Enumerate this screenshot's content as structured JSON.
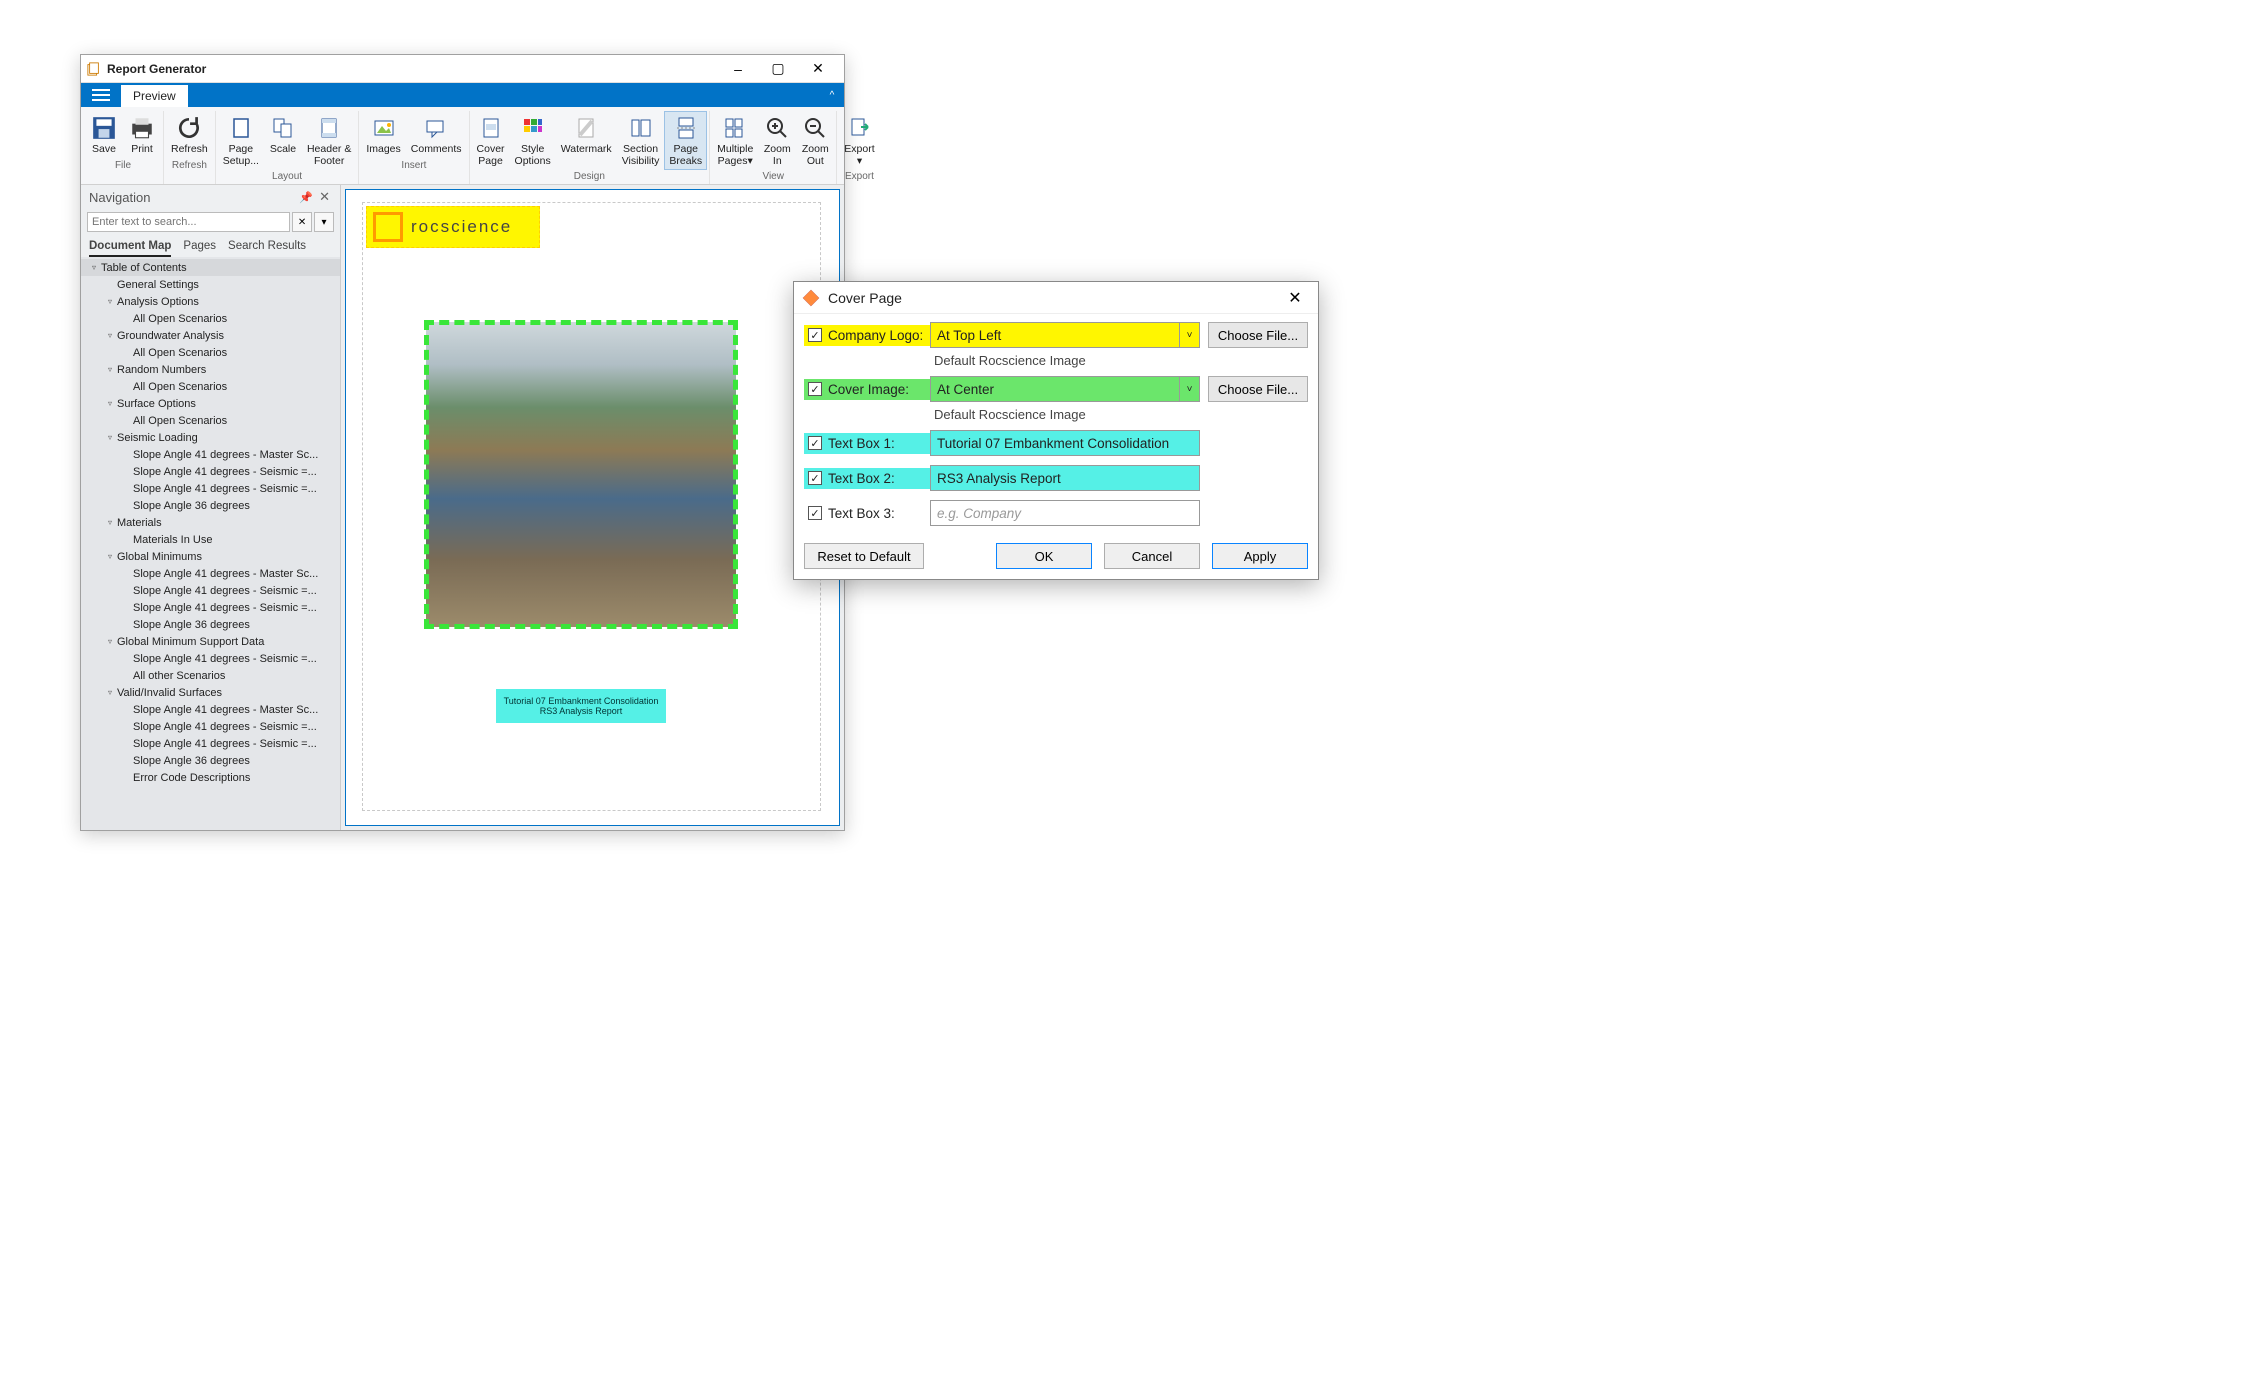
{
  "window": {
    "title": "Report Generator",
    "min_label": "–",
    "max_label": "▢",
    "close_label": "✕",
    "menu": {
      "preview": "Preview",
      "caret": "^"
    }
  },
  "ribbon": {
    "groups": {
      "file": {
        "label": "File",
        "save": "Save",
        "print": "Print"
      },
      "refresh": {
        "label": "Refresh",
        "refresh": "Refresh"
      },
      "layout": {
        "label": "Layout",
        "page_setup": "Page\nSetup...",
        "scale": "Scale",
        "header_footer": "Header &\nFooter"
      },
      "insert": {
        "label": "Insert",
        "images": "Images",
        "comments": "Comments"
      },
      "design": {
        "label": "Design",
        "cover": "Cover\nPage",
        "style": "Style\nOptions",
        "watermark": "Watermark",
        "section": "Section\nVisibility",
        "breaks": "Page\nBreaks"
      },
      "view": {
        "label": "View",
        "multi": "Multiple\nPages▾",
        "zin": "Zoom\nIn",
        "zout": "Zoom\nOut"
      },
      "export": {
        "label": "Export",
        "export": "Export\n▾"
      }
    }
  },
  "nav": {
    "title": "Navigation",
    "search_placeholder": "Enter text to search...",
    "clear": "✕",
    "go": "▾",
    "tabs": {
      "map": "Document Map",
      "pages": "Pages",
      "results": "Search Results"
    },
    "tree": [
      {
        "d": 0,
        "t": "Table of Contents",
        "tw": "▿",
        "sel": true
      },
      {
        "d": 1,
        "t": "General Settings"
      },
      {
        "d": 1,
        "t": "Analysis Options",
        "tw": "▿"
      },
      {
        "d": 2,
        "t": "All Open Scenarios"
      },
      {
        "d": 1,
        "t": "Groundwater Analysis",
        "tw": "▿"
      },
      {
        "d": 2,
        "t": "All Open Scenarios"
      },
      {
        "d": 1,
        "t": "Random Numbers",
        "tw": "▿"
      },
      {
        "d": 2,
        "t": "All Open Scenarios"
      },
      {
        "d": 1,
        "t": "Surface Options",
        "tw": "▿"
      },
      {
        "d": 2,
        "t": "All Open Scenarios"
      },
      {
        "d": 1,
        "t": "Seismic Loading",
        "tw": "▿"
      },
      {
        "d": 2,
        "t": "Slope Angle 41 degrees - Master Sc..."
      },
      {
        "d": 2,
        "t": "Slope Angle 41 degrees - Seismic =..."
      },
      {
        "d": 2,
        "t": "Slope Angle 41 degrees - Seismic =..."
      },
      {
        "d": 2,
        "t": "Slope Angle 36 degrees"
      },
      {
        "d": 1,
        "t": "Materials",
        "tw": "▿"
      },
      {
        "d": 2,
        "t": "Materials In Use"
      },
      {
        "d": 1,
        "t": "Global Minimums",
        "tw": "▿"
      },
      {
        "d": 2,
        "t": "Slope Angle 41 degrees - Master Sc..."
      },
      {
        "d": 2,
        "t": "Slope Angle 41 degrees - Seismic =..."
      },
      {
        "d": 2,
        "t": "Slope Angle 41 degrees - Seismic =..."
      },
      {
        "d": 2,
        "t": "Slope Angle 36 degrees"
      },
      {
        "d": 1,
        "t": "Global Minimum Support Data",
        "tw": "▿"
      },
      {
        "d": 2,
        "t": "Slope Angle 41 degrees - Seismic =..."
      },
      {
        "d": 2,
        "t": "All other Scenarios"
      },
      {
        "d": 1,
        "t": "Valid/Invalid Surfaces",
        "tw": "▿"
      },
      {
        "d": 2,
        "t": "Slope Angle 41 degrees - Master Sc..."
      },
      {
        "d": 2,
        "t": "Slope Angle 41 degrees - Seismic =..."
      },
      {
        "d": 2,
        "t": "Slope Angle 41 degrees - Seismic =..."
      },
      {
        "d": 2,
        "t": "Slope Angle 36 degrees"
      },
      {
        "d": 2,
        "t": "Error Code Descriptions"
      }
    ]
  },
  "preview": {
    "logo_text": "rocscience",
    "caption_l1": "Tutorial 07 Embankment Consolidation",
    "caption_l2": "RS3 Analysis Report"
  },
  "dialog": {
    "title": "Cover Page",
    "close": "✕",
    "rows": {
      "logo": {
        "label": "Company Logo:",
        "value": "At Top Left",
        "helper": "Default Rocscience Image",
        "choose": "Choose File..."
      },
      "cover": {
        "label": "Cover Image:",
        "value": "At Center",
        "helper": "Default Rocscience Image",
        "choose": "Choose File..."
      },
      "t1": {
        "label": "Text Box 1:",
        "value": "Tutorial 07 Embankment Consolidation"
      },
      "t2": {
        "label": "Text Box 2:",
        "value": "RS3 Analysis Report"
      },
      "t3": {
        "label": "Text Box 3:",
        "placeholder": "e.g. Company"
      }
    },
    "buttons": {
      "reset": "Reset to Default",
      "ok": "OK",
      "cancel": "Cancel",
      "apply": "Apply"
    },
    "check": "✓",
    "caret": "˅"
  }
}
